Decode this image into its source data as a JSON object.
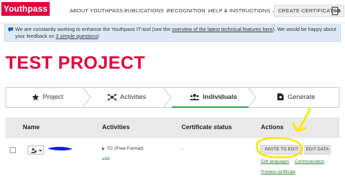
{
  "header": {
    "logo": "Youthpass",
    "nav": [
      {
        "label": "ABOUT YOUTHPASS"
      },
      {
        "label": "PUBLICATIONS"
      },
      {
        "label": "RECOGNITION"
      },
      {
        "label": "HELP & INSTRUCTIONS"
      }
    ],
    "cta": "CREATE CERTIFICATES"
  },
  "banner": {
    "text_before": "We are constantly working to enhance the Youthpass IT-tool (see the ",
    "link1": "overview of the latest technical features here",
    "text_middle": "). We would be happy about your feedback on ",
    "link2": "3 simple questions",
    "text_after": "!"
  },
  "page": {
    "title": "TEST PROJECT"
  },
  "steps": [
    {
      "label": "Project",
      "icon": "star-icon"
    },
    {
      "label": "Activities",
      "icon": "network-icon"
    },
    {
      "label": "Individuals",
      "icon": "users-icon",
      "active": true
    },
    {
      "label": "Generate",
      "icon": "certificate-icon"
    }
  ],
  "table": {
    "headers": [
      "Name",
      "Activities",
      "Certificate status",
      "Actions"
    ],
    "rows": [
      {
        "activity": "TC (Free Format)",
        "edit": "edit",
        "status": "-",
        "actions": {
          "invite": "INVITE TO EDIT",
          "edit_data": "EDIT DATA",
          "edit_languages": "Edit languages",
          "communication": "Communication",
          "preview": "Preview certificate"
        }
      }
    ]
  },
  "colors": {
    "brand": "#e2003c",
    "active_step": "#2e9c4f",
    "annotation": "#ffe600",
    "redaction": "#1a1aff"
  }
}
